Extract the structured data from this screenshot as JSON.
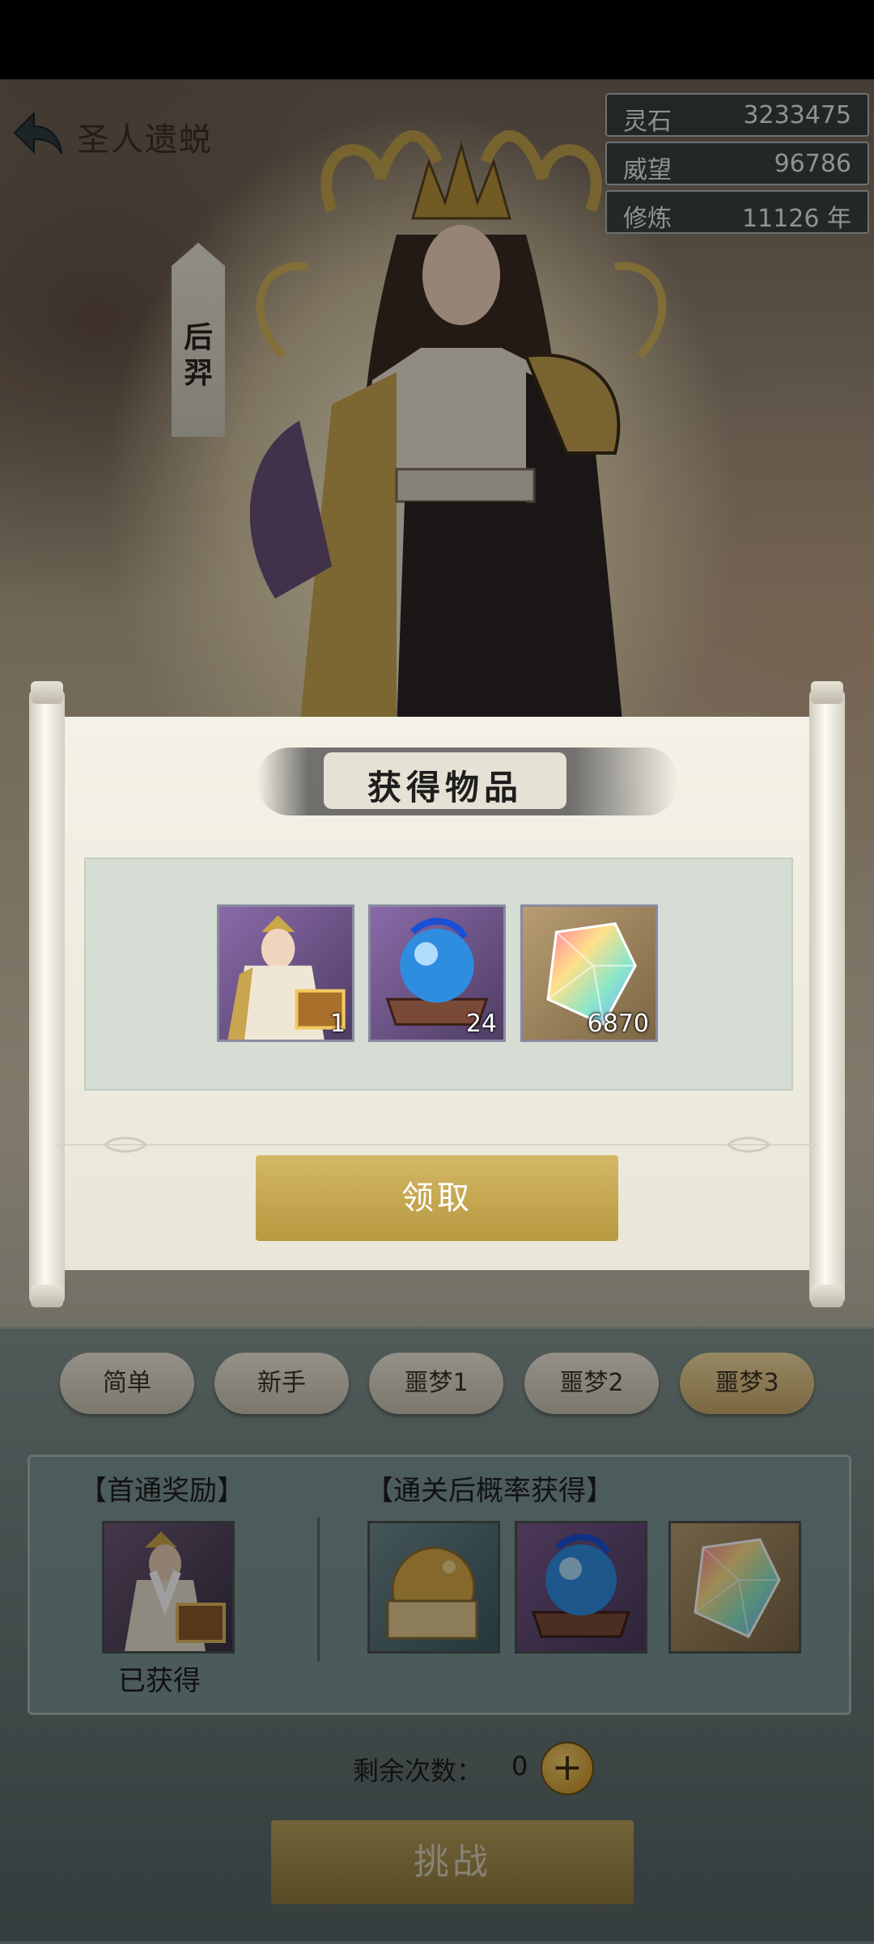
{
  "header": {
    "title": "圣人遗蜕"
  },
  "resources": [
    {
      "label": "灵石",
      "value": "3233475"
    },
    {
      "label": "威望",
      "value": "96786"
    },
    {
      "label": "修炼",
      "value": "11126 年"
    }
  ],
  "character": {
    "name": "后羿"
  },
  "modal": {
    "title": "获得物品",
    "items": [
      {
        "icon": "character-chest-icon",
        "quantity": "1"
      },
      {
        "icon": "blue-orb-icon",
        "quantity": "24"
      },
      {
        "icon": "rainbow-crystal-icon",
        "quantity": "6870"
      }
    ],
    "claim_label": "领取"
  },
  "difficulties": [
    "简单",
    "新手",
    "噩梦1",
    "噩梦2",
    "噩梦3"
  ],
  "selected_difficulty": "噩梦3",
  "rewards": {
    "first_clear_header": "【首通奖励】",
    "first_clear_status": "已获得",
    "chance_header": "【通关后概率获得】",
    "chance_items": [
      "golden-seal-icon",
      "blue-orb-icon",
      "rainbow-crystal-icon"
    ]
  },
  "attempts": {
    "label": "剩余次数：",
    "count": "0"
  },
  "challenge_label": "挑战",
  "colors": {
    "gold_button": "#c9a850",
    "panel": "#7d9696",
    "scroll": "#f1eee3"
  }
}
